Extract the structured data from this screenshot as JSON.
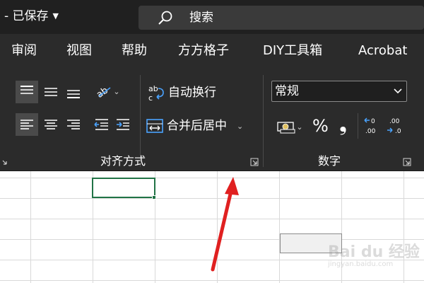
{
  "titlebar": {
    "status": "- 已保存",
    "search_label": "搜索"
  },
  "tabs": [
    "审阅",
    "视图",
    "帮助",
    "方方格子",
    "DIY工具箱",
    "Acrobat"
  ],
  "ribbon": {
    "alignment_group": {
      "label": "对齐方式",
      "wrap_text": "自动换行",
      "merge_center": "合并后居中",
      "active_alignment": "top-align"
    },
    "number_group": {
      "label": "数字",
      "format_value": "常规",
      "percent_symbol": "%",
      "comma_symbol": "❟"
    }
  },
  "icons": [
    "search-icon",
    "top-align-icon",
    "middle-align-icon",
    "bottom-align-icon",
    "orientation-icon",
    "left-align-icon",
    "center-align-icon",
    "right-align-icon",
    "decrease-indent-icon",
    "increase-indent-icon",
    "wrap-text-icon",
    "merge-center-icon",
    "accounting-format-icon",
    "increase-decimal-icon",
    "decrease-decimal-icon",
    "dialog-launcher-icon"
  ],
  "colors": {
    "titlebar": "#202020",
    "ribbon": "#2b2b2b",
    "selection": "#217346",
    "annotation_arrow": "#e02020",
    "wrap_icon_blue": "#4aa3ff"
  },
  "watermark": {
    "text": "Bai du 经验",
    "url": "jingyan.baidu.com"
  }
}
